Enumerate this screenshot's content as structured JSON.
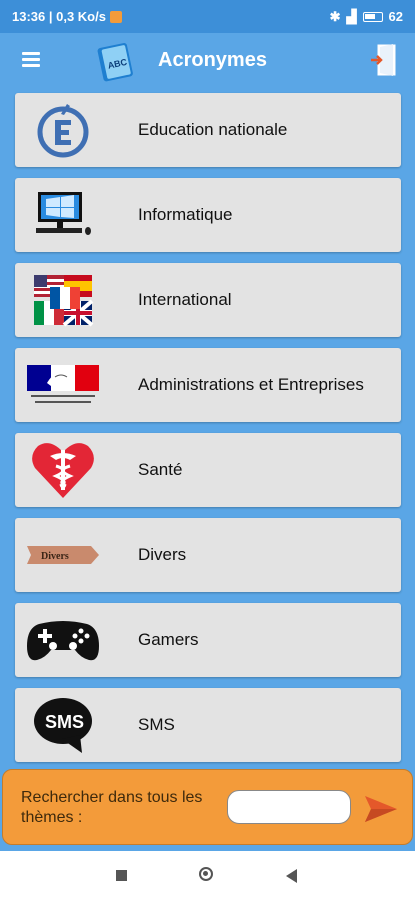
{
  "status_bar": {
    "time_info": "13:36 | 0,3 Ko/s",
    "battery": "62"
  },
  "app_bar": {
    "title": "Acronymes",
    "logo_text": "ABC"
  },
  "themes": [
    {
      "label": "Education nationale",
      "icon": "education-nationale-logo"
    },
    {
      "label": "Informatique",
      "icon": "computer-icon"
    },
    {
      "label": "International",
      "icon": "flags-icon"
    },
    {
      "label": "Administrations et Entreprises",
      "icon": "marianne-logo"
    },
    {
      "label": "Santé",
      "icon": "health-heart-icon"
    },
    {
      "label": "Divers",
      "icon": "divers-banner-icon",
      "icon_text": "Divers"
    },
    {
      "label": "Gamers",
      "icon": "gamepad-icon"
    },
    {
      "label": "SMS",
      "icon": "sms-bubble-icon",
      "icon_text": "SMS"
    }
  ],
  "search": {
    "label": "Rechercher dans tous les thèmes :",
    "placeholder": ""
  },
  "colors": {
    "app_blue": "#5aa6e6",
    "item_gray": "#e3e3e3",
    "search_orange": "#f39b3a",
    "send_red": "#e4582a"
  }
}
